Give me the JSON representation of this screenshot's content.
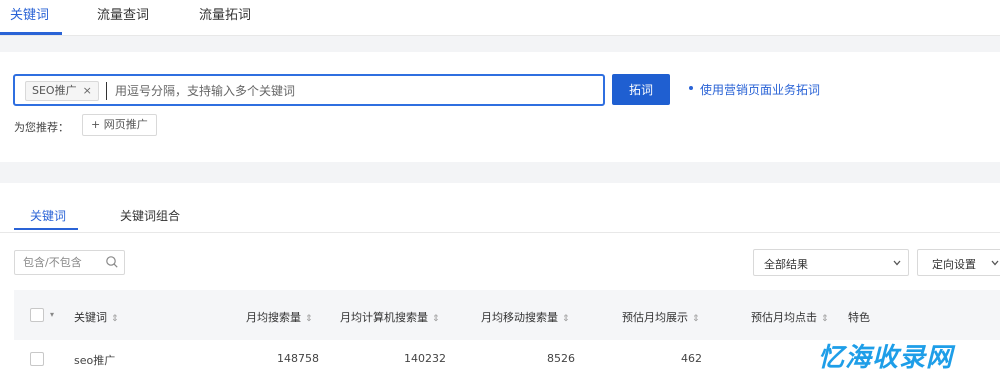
{
  "top_tabs": [
    {
      "label": "关键词"
    },
    {
      "label": "流量查词"
    },
    {
      "label": "流量拓词"
    }
  ],
  "search": {
    "chip_label": "SEO推广",
    "chip_close": "×",
    "placeholder": "用逗号分隔，支持输入多个关键词",
    "button_label": "拓词",
    "business_link": "使用营销页面业务拓词"
  },
  "recommend": {
    "label": "为您推荐：",
    "chip": "+ 网页推广"
  },
  "sub_tabs": [
    {
      "label": "关键词"
    },
    {
      "label": "关键词组合"
    }
  ],
  "filter": {
    "placeholder": "包含/不包含"
  },
  "select_all": "全部结果",
  "settings": "定向设置",
  "table": {
    "columns": [
      "关键词",
      "月均搜索量",
      "月均计算机搜索量",
      "月均移动搜索量",
      "预估月均展示",
      "预估月均点击",
      "特色"
    ],
    "rows": [
      {
        "keyword": "seo推广",
        "monthly": "148758",
        "pc": "140232",
        "mobile": "8526",
        "impressions": "462",
        "clicks": "",
        "feature": ""
      }
    ]
  },
  "watermark": "忆海收录网",
  "colors": {
    "accent": "#2a63d6",
    "button": "#1f5fd1",
    "watermark": "#1e9ee8"
  }
}
